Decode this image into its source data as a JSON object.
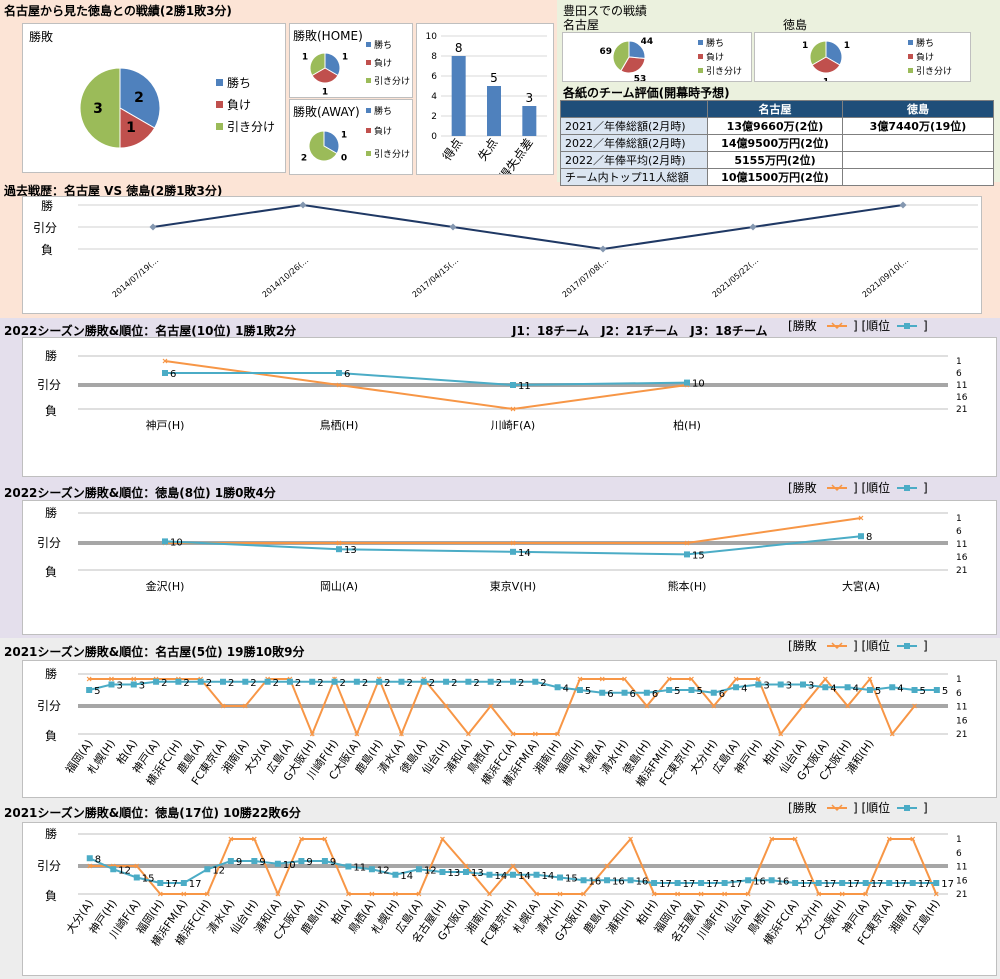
{
  "section1": {
    "title": "名古屋から見た徳島との戦績(2勝1敗3分)"
  },
  "pie_legend": {
    "win": "勝ち",
    "lose": "負け",
    "draw": "引き分け"
  },
  "pie_total": {
    "title": "勝敗"
  },
  "pie_home": {
    "title": "勝敗(HOME)"
  },
  "pie_away": {
    "title": "勝敗(AWAY)"
  },
  "toyota": {
    "title": "豊田スでの戦績",
    "nagoya": "名古屋",
    "tokushima": "徳島"
  },
  "eval": {
    "title": "各紙のチーム評価(開幕時予想)",
    "headers": [
      "",
      "名古屋",
      "徳島"
    ],
    "rows": [
      [
        "2021／年俸総額(2月時)",
        "13億9660万(2位)",
        "3億7440万(19位)"
      ],
      [
        "2022／年俸総額(2月時)",
        "14億9500万円(2位)",
        ""
      ],
      [
        "2022／年俸平均(2月時)",
        "5155万円(2位)",
        ""
      ],
      [
        "チーム内トップ11人総額",
        "10億1500万円(2位)",
        ""
      ]
    ]
  },
  "history": {
    "title": "過去戦歴：名古屋 VS 徳島(2勝1敗3分)"
  },
  "s2022n": {
    "title": "2022シーズン勝敗&順位：名古屋(10位) 1勝1敗2分",
    "teams": "J1：18チーム　J2：21チーム　J3：18チーム"
  },
  "s2022t": {
    "title": "2022シーズン勝敗&順位：徳島(8位) 1勝0敗4分"
  },
  "s2021n": {
    "title": "2021シーズン勝敗&順位：名古屋(5位) 19勝10敗9分"
  },
  "s2021t": {
    "title": "2021シーズン勝敗&順位：徳島(17位) 10勝22敗6分"
  },
  "legend": {
    "result": "[勝敗",
    "rank": "] [順位",
    "close": "]"
  },
  "result_axis": {
    "win": "勝",
    "draw": "引分",
    "lose": "負"
  },
  "rank_ticks": [
    "1",
    "6",
    "11",
    "16",
    "21"
  ],
  "colors": {
    "win": "#4f81bd",
    "lose": "#c0504d",
    "draw": "#9bbb59",
    "bar": "#4f81bd",
    "result_line": "#f79646",
    "rank_line": "#4bacc6",
    "history_line": "#1f3864"
  },
  "chart_data": [
    {
      "id": "pie_total",
      "type": "pie",
      "categories": [
        "勝ち",
        "負け",
        "引き分け"
      ],
      "values": [
        2,
        1,
        3
      ]
    },
    {
      "id": "pie_home",
      "type": "pie",
      "categories": [
        "勝ち",
        "負け",
        "引き分け"
      ],
      "values": [
        1,
        1,
        1
      ]
    },
    {
      "id": "pie_away",
      "type": "pie",
      "categories": [
        "勝ち",
        "負け",
        "引き分け"
      ],
      "values": [
        1,
        0,
        2
      ]
    },
    {
      "id": "goals",
      "type": "bar",
      "categories": [
        "得点",
        "失点",
        "得失点差"
      ],
      "values": [
        8,
        5,
        3
      ],
      "ylim": [
        0,
        10
      ],
      "yticks": [
        0,
        2,
        4,
        6,
        8,
        10
      ]
    },
    {
      "id": "pie_toyota_nagoya",
      "type": "pie",
      "categories": [
        "勝ち",
        "負け",
        "引き分け"
      ],
      "values": [
        44,
        53,
        69
      ]
    },
    {
      "id": "pie_toyota_tokushima",
      "type": "pie",
      "categories": [
        "勝ち",
        "負け",
        "引き分け"
      ],
      "values": [
        1,
        1,
        1
      ]
    },
    {
      "id": "history",
      "type": "line",
      "x": [
        "2014/07/19(…",
        "2014/10/26(…",
        "2017/04/15(…",
        "2017/07/08(…",
        "2021/05/22(…",
        "2021/09/10(…"
      ],
      "result": [
        0,
        1,
        0,
        -1,
        0,
        1
      ]
    },
    {
      "id": "s2022n",
      "type": "line",
      "x": [
        "神戸(H)",
        "鳥栖(H)",
        "川崎F(A)",
        "柏(H)"
      ],
      "result": [
        1,
        0,
        -1,
        0
      ],
      "rank": [
        6,
        6,
        11,
        10
      ]
    },
    {
      "id": "s2022t",
      "type": "line",
      "x": [
        "金沢(H)",
        "岡山(A)",
        "東京V(H)",
        "熊本(H)",
        "大宮(A)"
      ],
      "result": [
        0,
        0,
        0,
        0,
        1
      ],
      "rank": [
        10,
        13,
        14,
        15,
        8
      ]
    },
    {
      "id": "s2021n",
      "type": "line",
      "x": [
        "福岡(A)",
        "札幌(H)",
        "柏(A)",
        "神戸(A)",
        "横浜FC(H)",
        "鹿島(A)",
        "FC東京(A)",
        "湘南(A)",
        "大分(A)",
        "広島(A)",
        "G大阪(H)",
        "川崎F(H)",
        "C大阪(A)",
        "鹿島(H)",
        "清水(A)",
        "徳島(A)",
        "仙台(H)",
        "浦和(A)",
        "鳥栖(A)",
        "横浜FC(A)",
        "横浜FM(A)",
        "湘南(H)",
        "福岡(H)",
        "札幌(A)",
        "清水(H)",
        "徳島(H)",
        "横浜FM(H)",
        "FC東京(H)",
        "大分(H)",
        "広島(A)",
        "神戸(H)",
        "柏(H)",
        "仙台(A)",
        "G大阪(A)",
        "C大阪(H)",
        "浦和(H)"
      ],
      "x_extra": [
        "",
        ""
      ],
      "result": [
        1,
        1,
        1,
        1,
        1,
        1,
        0,
        0,
        1,
        1,
        -1,
        1,
        -1,
        1,
        -1,
        1,
        0,
        -1,
        0,
        -1,
        -1,
        -1,
        1,
        1,
        1,
        0,
        1,
        1,
        0,
        1,
        1,
        -1,
        0,
        1,
        0,
        1,
        -1,
        0
      ],
      "rank": [
        5,
        3,
        3,
        2,
        2,
        2,
        2,
        2,
        2,
        2,
        2,
        2,
        2,
        2,
        2,
        2,
        2,
        2,
        2,
        2,
        2,
        4,
        5,
        6,
        6,
        6,
        5,
        5,
        6,
        4,
        3,
        3,
        3,
        4,
        4,
        5,
        4,
        5,
        5
      ]
    },
    {
      "id": "s2021t",
      "type": "line",
      "x": [
        "大分(A)",
        "神戸(H)",
        "川崎F(A)",
        "福岡(H)",
        "横浜FM(A)",
        "横浜FC(H)",
        "清水(A)",
        "仙台(H)",
        "浦和(A)",
        "C大阪(A)",
        "鹿島(H)",
        "柏(A)",
        "鳥栖(A)",
        "札幌(H)",
        "広島(A)",
        "名古屋(H)",
        "G大阪(A)",
        "湘南(H)",
        "FC東京(H)",
        "札幌(A)",
        "清水(H)",
        "G大阪(H)",
        "鹿島(A)",
        "浦和(H)",
        "柏(H)",
        "福岡(A)",
        "名古屋(A)",
        "川崎F(H)",
        "仙台(A)",
        "鳥栖(H)",
        "横浜FC(A)",
        "大分(H)",
        "C大阪(H)",
        "神戸(A)",
        "FC東京(A)",
        "湘南(A)",
        "広島(H)"
      ],
      "result": [
        0,
        0,
        0,
        -1,
        -1,
        -1,
        1,
        1,
        -1,
        1,
        1,
        -1,
        -1,
        -1,
        -1,
        1,
        0,
        -1,
        0,
        -1,
        -1,
        -1,
        0,
        1,
        -1,
        -1,
        -1,
        -1,
        -1,
        1,
        1,
        -1,
        -1,
        -1,
        1,
        1,
        -1
      ],
      "rank": [
        8,
        12,
        15,
        17,
        17,
        12,
        9,
        9,
        10,
        9,
        9,
        11,
        12,
        14,
        12,
        13,
        13,
        14,
        14,
        14,
        15,
        16,
        16,
        16,
        17,
        17,
        17,
        17,
        16,
        16,
        17,
        17,
        17,
        17,
        17,
        17,
        17
      ]
    }
  ]
}
